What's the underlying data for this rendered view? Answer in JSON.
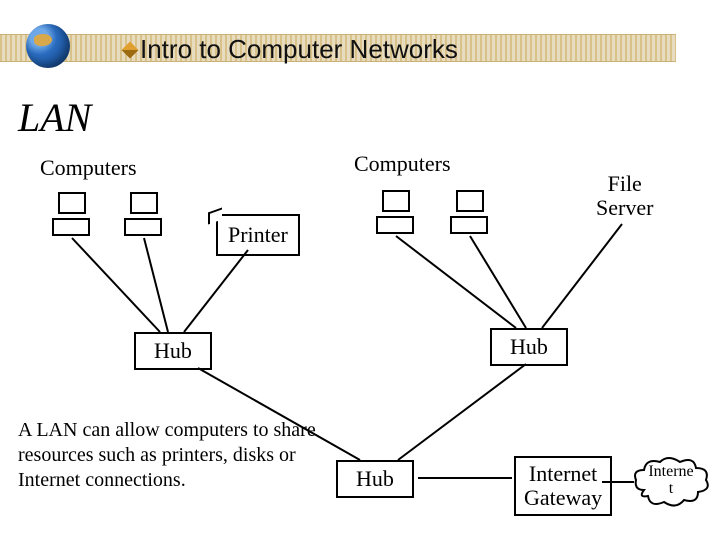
{
  "header": {
    "title": "Intro to Computer Networks"
  },
  "heading": "LAN",
  "labels": {
    "computers_left": "Computers",
    "computers_right": "Computers",
    "file_server": "File\nServer",
    "printer": "Printer",
    "hub_left": "Hub",
    "hub_right": "Hub",
    "hub_center": "Hub",
    "internet_gateway": "Internet\nGateway",
    "internet": "Interne\nt"
  },
  "description": "A LAN can allow computers to share resources such as printers, disks or Internet connections.",
  "diagram": {
    "left_group": {
      "computers": 2,
      "has_printer": true,
      "connects_to": "hub_left"
    },
    "right_group": {
      "computers": 2,
      "has_file_server": true,
      "connects_to": "hub_right"
    },
    "backbone": {
      "hub_left": "hub_center",
      "hub_right": "hub_center",
      "hub_center_to": "internet_gateway",
      "internet_gateway_to": "internet"
    }
  }
}
